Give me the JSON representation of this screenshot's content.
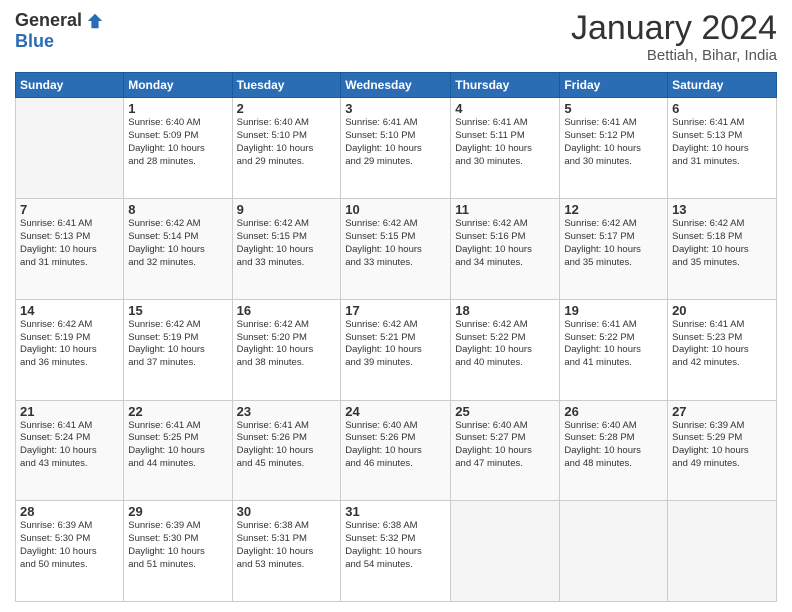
{
  "header": {
    "logo_general": "General",
    "logo_blue": "Blue",
    "month_title": "January 2024",
    "location": "Bettiah, Bihar, India"
  },
  "calendar": {
    "days_of_week": [
      "Sunday",
      "Monday",
      "Tuesday",
      "Wednesday",
      "Thursday",
      "Friday",
      "Saturday"
    ],
    "weeks": [
      [
        {
          "date": "",
          "info": ""
        },
        {
          "date": "1",
          "info": "Sunrise: 6:40 AM\nSunset: 5:09 PM\nDaylight: 10 hours\nand 28 minutes."
        },
        {
          "date": "2",
          "info": "Sunrise: 6:40 AM\nSunset: 5:10 PM\nDaylight: 10 hours\nand 29 minutes."
        },
        {
          "date": "3",
          "info": "Sunrise: 6:41 AM\nSunset: 5:10 PM\nDaylight: 10 hours\nand 29 minutes."
        },
        {
          "date": "4",
          "info": "Sunrise: 6:41 AM\nSunset: 5:11 PM\nDaylight: 10 hours\nand 30 minutes."
        },
        {
          "date": "5",
          "info": "Sunrise: 6:41 AM\nSunset: 5:12 PM\nDaylight: 10 hours\nand 30 minutes."
        },
        {
          "date": "6",
          "info": "Sunrise: 6:41 AM\nSunset: 5:13 PM\nDaylight: 10 hours\nand 31 minutes."
        }
      ],
      [
        {
          "date": "7",
          "info": "Sunrise: 6:41 AM\nSunset: 5:13 PM\nDaylight: 10 hours\nand 31 minutes."
        },
        {
          "date": "8",
          "info": "Sunrise: 6:42 AM\nSunset: 5:14 PM\nDaylight: 10 hours\nand 32 minutes."
        },
        {
          "date": "9",
          "info": "Sunrise: 6:42 AM\nSunset: 5:15 PM\nDaylight: 10 hours\nand 33 minutes."
        },
        {
          "date": "10",
          "info": "Sunrise: 6:42 AM\nSunset: 5:15 PM\nDaylight: 10 hours\nand 33 minutes."
        },
        {
          "date": "11",
          "info": "Sunrise: 6:42 AM\nSunset: 5:16 PM\nDaylight: 10 hours\nand 34 minutes."
        },
        {
          "date": "12",
          "info": "Sunrise: 6:42 AM\nSunset: 5:17 PM\nDaylight: 10 hours\nand 35 minutes."
        },
        {
          "date": "13",
          "info": "Sunrise: 6:42 AM\nSunset: 5:18 PM\nDaylight: 10 hours\nand 35 minutes."
        }
      ],
      [
        {
          "date": "14",
          "info": "Sunrise: 6:42 AM\nSunset: 5:19 PM\nDaylight: 10 hours\nand 36 minutes."
        },
        {
          "date": "15",
          "info": "Sunrise: 6:42 AM\nSunset: 5:19 PM\nDaylight: 10 hours\nand 37 minutes."
        },
        {
          "date": "16",
          "info": "Sunrise: 6:42 AM\nSunset: 5:20 PM\nDaylight: 10 hours\nand 38 minutes."
        },
        {
          "date": "17",
          "info": "Sunrise: 6:42 AM\nSunset: 5:21 PM\nDaylight: 10 hours\nand 39 minutes."
        },
        {
          "date": "18",
          "info": "Sunrise: 6:42 AM\nSunset: 5:22 PM\nDaylight: 10 hours\nand 40 minutes."
        },
        {
          "date": "19",
          "info": "Sunrise: 6:41 AM\nSunset: 5:22 PM\nDaylight: 10 hours\nand 41 minutes."
        },
        {
          "date": "20",
          "info": "Sunrise: 6:41 AM\nSunset: 5:23 PM\nDaylight: 10 hours\nand 42 minutes."
        }
      ],
      [
        {
          "date": "21",
          "info": "Sunrise: 6:41 AM\nSunset: 5:24 PM\nDaylight: 10 hours\nand 43 minutes."
        },
        {
          "date": "22",
          "info": "Sunrise: 6:41 AM\nSunset: 5:25 PM\nDaylight: 10 hours\nand 44 minutes."
        },
        {
          "date": "23",
          "info": "Sunrise: 6:41 AM\nSunset: 5:26 PM\nDaylight: 10 hours\nand 45 minutes."
        },
        {
          "date": "24",
          "info": "Sunrise: 6:40 AM\nSunset: 5:26 PM\nDaylight: 10 hours\nand 46 minutes."
        },
        {
          "date": "25",
          "info": "Sunrise: 6:40 AM\nSunset: 5:27 PM\nDaylight: 10 hours\nand 47 minutes."
        },
        {
          "date": "26",
          "info": "Sunrise: 6:40 AM\nSunset: 5:28 PM\nDaylight: 10 hours\nand 48 minutes."
        },
        {
          "date": "27",
          "info": "Sunrise: 6:39 AM\nSunset: 5:29 PM\nDaylight: 10 hours\nand 49 minutes."
        }
      ],
      [
        {
          "date": "28",
          "info": "Sunrise: 6:39 AM\nSunset: 5:30 PM\nDaylight: 10 hours\nand 50 minutes."
        },
        {
          "date": "29",
          "info": "Sunrise: 6:39 AM\nSunset: 5:30 PM\nDaylight: 10 hours\nand 51 minutes."
        },
        {
          "date": "30",
          "info": "Sunrise: 6:38 AM\nSunset: 5:31 PM\nDaylight: 10 hours\nand 53 minutes."
        },
        {
          "date": "31",
          "info": "Sunrise: 6:38 AM\nSunset: 5:32 PM\nDaylight: 10 hours\nand 54 minutes."
        },
        {
          "date": "",
          "info": ""
        },
        {
          "date": "",
          "info": ""
        },
        {
          "date": "",
          "info": ""
        }
      ]
    ]
  }
}
